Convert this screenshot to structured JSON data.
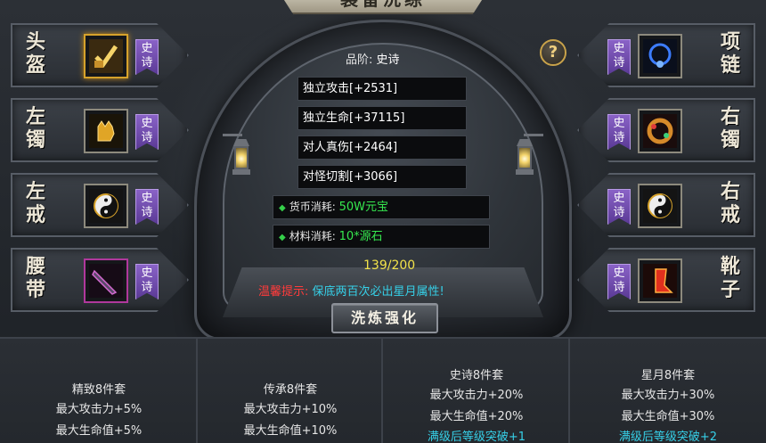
{
  "title": "装备洗练",
  "help_label": "?",
  "slots_left": [
    {
      "name": "头盔",
      "grade": "史诗",
      "icon": "helmet-icon"
    },
    {
      "name": "左镯",
      "grade": "史诗",
      "icon": "bracelet-icon"
    },
    {
      "name": "左戒",
      "grade": "史诗",
      "icon": "ring-icon"
    },
    {
      "name": "腰带",
      "grade": "史诗",
      "icon": "belt-icon"
    }
  ],
  "slots_right": [
    {
      "name": "项链",
      "grade": "史诗",
      "icon": "necklace-icon"
    },
    {
      "name": "右镯",
      "grade": "史诗",
      "icon": "bracelet-icon"
    },
    {
      "name": "右戒",
      "grade": "史诗",
      "icon": "ring-icon"
    },
    {
      "name": "靴子",
      "grade": "史诗",
      "icon": "boots-icon"
    }
  ],
  "panel": {
    "grade_label": "品阶:",
    "grade_value": "史诗",
    "attributes": [
      "独立攻击[+2531]",
      "独立生命[+37115]",
      "对人真伤[+2464]",
      "对怪切割[+3066]"
    ],
    "currency_label": "货币消耗:",
    "currency_value": "50W元宝",
    "material_label": "材料消耗:",
    "material_value": "10*源石",
    "progress": "139/200",
    "tip_label": "温馨提示:",
    "tip_text": "保底两百次必出星月属性!",
    "refine_button": "洗炼强化"
  },
  "sets": [
    {
      "title": "精致8件套",
      "lines": [
        "最大攻击力+5%",
        "最大生命值+5%"
      ]
    },
    {
      "title": "传承8件套",
      "lines": [
        "最大攻击力+10%",
        "最大生命值+10%"
      ]
    },
    {
      "title": "史诗8件套",
      "lines": [
        "最大攻击力+20%",
        "最大生命值+20%"
      ],
      "bonus": "满级后等级突破+1"
    },
    {
      "title": "星月8件套",
      "lines": [
        "最大攻击力+30%",
        "最大生命值+30%"
      ],
      "bonus": "满级后等级突破+2"
    }
  ]
}
